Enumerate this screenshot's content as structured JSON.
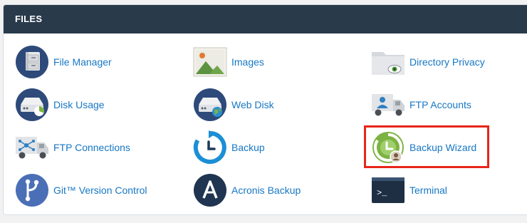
{
  "section": {
    "title": "FILES"
  },
  "items": [
    {
      "label": "File Manager"
    },
    {
      "label": "Images"
    },
    {
      "label": "Directory Privacy"
    },
    {
      "label": "Disk Usage"
    },
    {
      "label": "Web Disk"
    },
    {
      "label": "FTP Accounts"
    },
    {
      "label": "FTP Connections"
    },
    {
      "label": "Backup"
    },
    {
      "label": "Backup Wizard"
    },
    {
      "label": "Git™ Version Control"
    },
    {
      "label": "Acronis Backup"
    },
    {
      "label": "Terminal"
    }
  ],
  "icons": {
    "file_manager": "file-cabinet-icon",
    "images": "landscape-image-icon",
    "directory_privacy": "folder-eye-icon",
    "disk_usage": "hard-drive-pie-icon",
    "web_disk": "hard-drive-globe-icon",
    "ftp_accounts": "truck-user-icon",
    "ftp_connections": "truck-network-icon",
    "backup": "clock-refresh-icon",
    "backup_wizard": "clock-wizard-icon",
    "git": "git-branch-icon",
    "acronis": "acronis-logo-icon",
    "terminal": "terminal-prompt-icon"
  },
  "colors": {
    "header_bg": "#293a4a",
    "link": "#1777c4",
    "highlight": "#e8251a",
    "icon_navy": "#2d4a7a",
    "icon_blue": "#1b8fd6",
    "icon_green": "#7cb342"
  }
}
